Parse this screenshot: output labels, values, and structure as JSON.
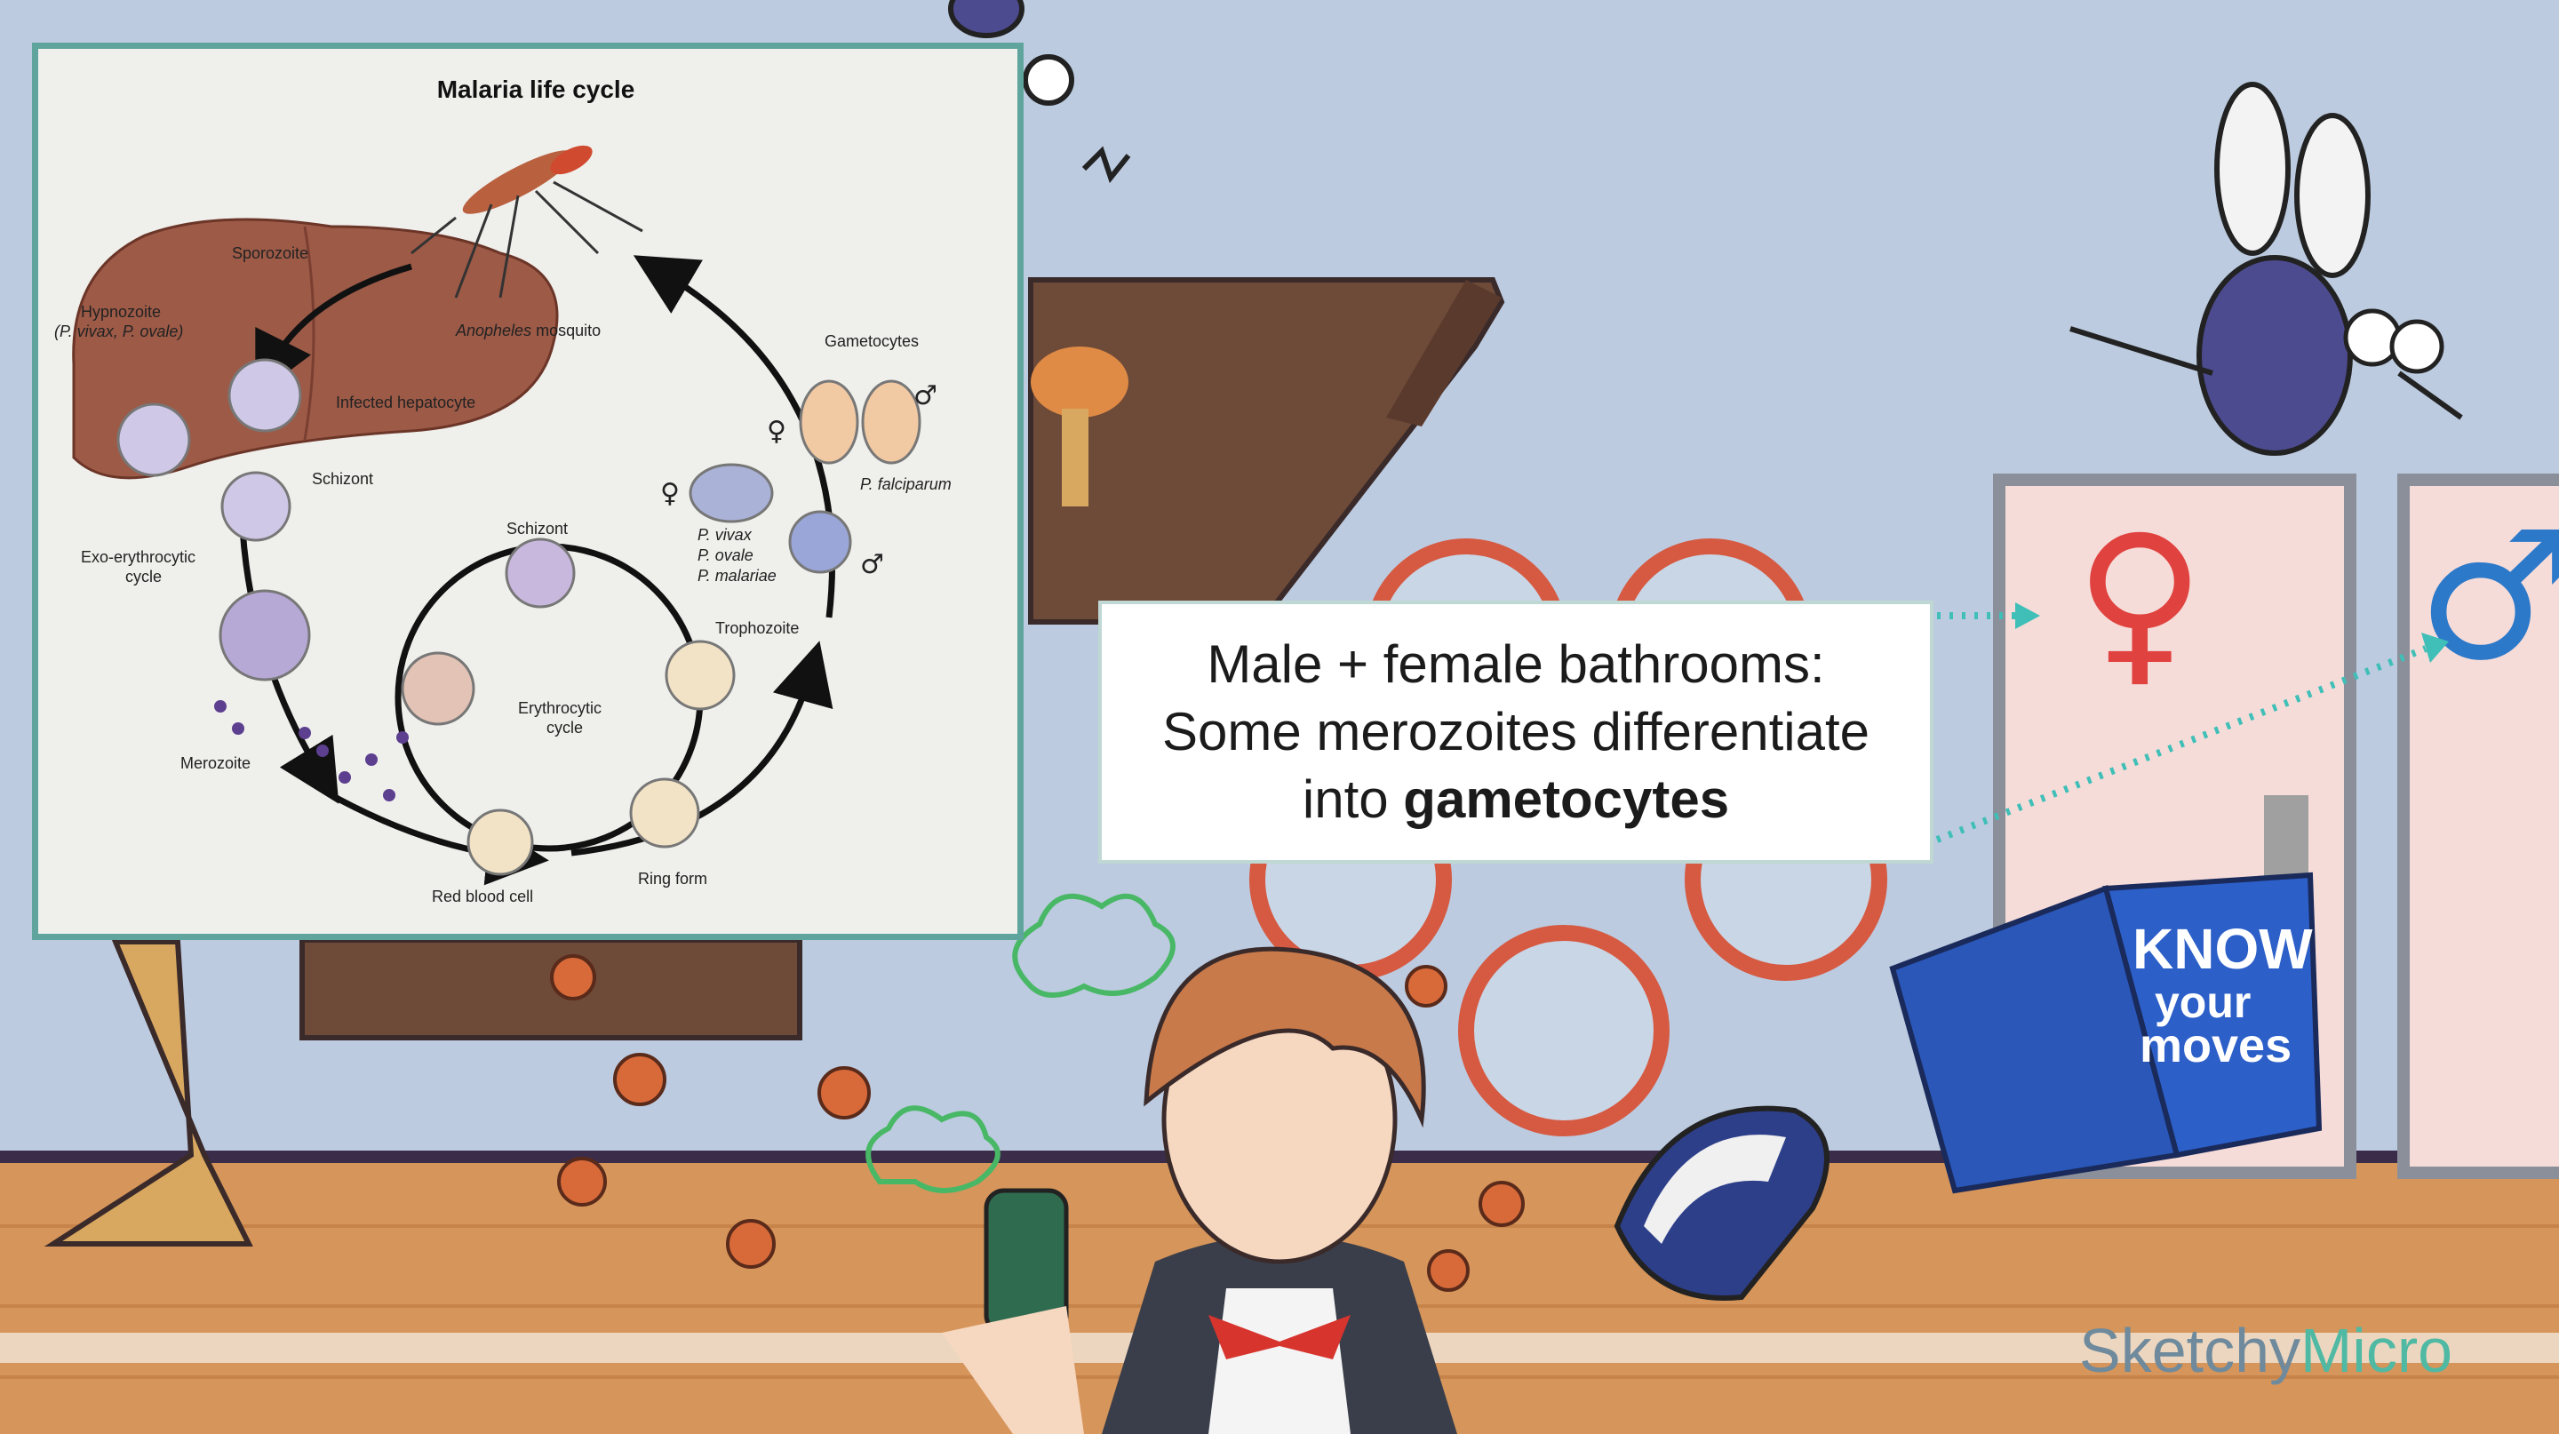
{
  "diagram": {
    "title": "Malaria life cycle",
    "labels": {
      "sporozoite": "Sporozoite",
      "mosquito": "Anopheles",
      "mosquito_suffix": " mosquito",
      "gametocytes": "Gametocytes",
      "hypnozoite": "Hypnozoite",
      "hypnozoite_species": "(P. vivax, P. ovale)",
      "infected_hepatocyte": "Infected hepatocyte",
      "schizont_liver": "Schizont",
      "exo_cycle_1": "Exo-erythrocytic",
      "exo_cycle_2": "cycle",
      "schizont_blood": "Schizont",
      "trophozoite": "Trophozoite",
      "ery_cycle_1": "Erythrocytic",
      "ery_cycle_2": "cycle",
      "merozoite": "Merozoite",
      "rbc": "Red blood cell",
      "ring_form": "Ring form",
      "p_falciparum": "P. falciparum",
      "p_vivax": "P. vivax",
      "p_ovale": "P. ovale",
      "p_malariae": "P. malariae"
    },
    "symbols": {
      "female": "♀",
      "male": "♂"
    }
  },
  "caption": {
    "line1": "Male + female bathrooms:",
    "line2": "Some merozoites differentiate",
    "line3_prefix": "into ",
    "line3_bold": "gametocytes"
  },
  "scene": {
    "door_female_symbol": "♀",
    "door_male_symbol": "♂",
    "book_line1": "KNOW",
    "book_line2": "your",
    "book_line3": "moves"
  },
  "brand": {
    "part1": "Sketchy",
    "part2": "Micro"
  },
  "colors": {
    "panel_border": "#5fa59d",
    "female_symbol": "#e0433f",
    "male_symbol": "#2c79c9",
    "brand_teal": "#4fb9a4",
    "wall": "#b7c7dd",
    "floor": "#d99a5e"
  },
  "icons": [
    "mosquito-icon",
    "female-symbol-icon",
    "male-symbol-icon",
    "basketball-icon",
    "spray-can-icon"
  ]
}
